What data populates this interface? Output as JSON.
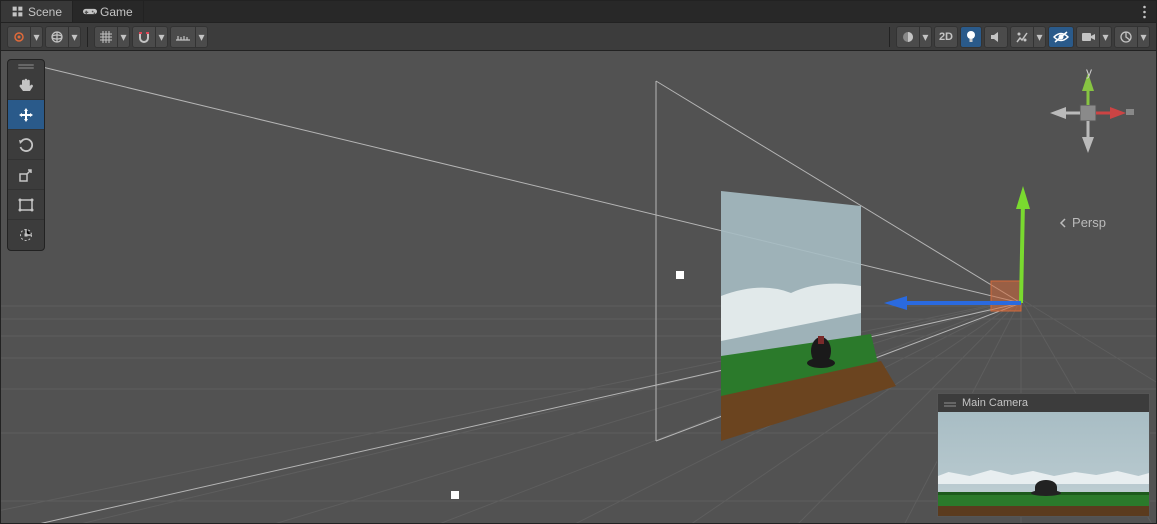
{
  "tabs": {
    "scene": "Scene",
    "game": "Game"
  },
  "toolbar": {
    "left": {
      "pivotmode": "center-pivot",
      "handlerot": "global-handle",
      "grid": "grid",
      "snap": "snap",
      "increment": "increment-snap"
    },
    "right": {
      "drawmode": "draw-mode",
      "twod": "2D",
      "lighting": "lighting",
      "audio": "audio",
      "fx": "fx",
      "hidden": "visibility",
      "camera": "camera",
      "gizmos": "gizmos"
    }
  },
  "tools": {
    "hand": "hand-tool",
    "move": "move-tool",
    "rotate": "rotate-tool",
    "scale": "scale-tool",
    "rect": "rect-tool",
    "transform": "transform-tool"
  },
  "gizmo": {
    "y_label": "y"
  },
  "projection": "Persp",
  "camera_preview": {
    "title": "Main Camera"
  }
}
